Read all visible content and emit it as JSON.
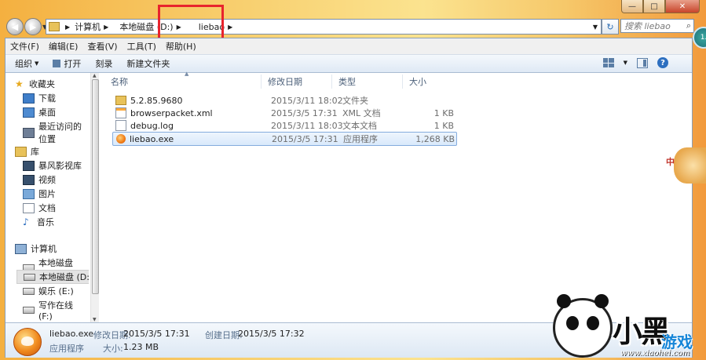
{
  "window": {
    "controls": {
      "minimize": "—",
      "maximize": "□",
      "close": "✕"
    }
  },
  "address_bar": {
    "crumbs": [
      "计算机",
      "本地磁盘 (D:)",
      "liebao"
    ],
    "search_placeholder": "搜索 liebao"
  },
  "menu": [
    "文件(F)",
    "编辑(E)",
    "查看(V)",
    "工具(T)",
    "帮助(H)"
  ],
  "toolbar": {
    "organize": "组织",
    "open": "打开",
    "burn": "刻录",
    "new_folder": "新建文件夹"
  },
  "sidebar": {
    "favorites": {
      "label": "收藏夹",
      "items": [
        "下载",
        "桌面",
        "最近访问的位置"
      ]
    },
    "libraries": {
      "label": "库",
      "items": [
        "暴风影视库",
        "视频",
        "图片",
        "文档",
        "音乐"
      ]
    },
    "computer": {
      "label": "计算机",
      "items": [
        "本地磁盘 (C:)",
        "本地磁盘 (D:)",
        "娱乐 (E:)",
        "写作在线 (F:)"
      ],
      "selected": "本地磁盘 (D:)"
    }
  },
  "columns": [
    "名称",
    "修改日期",
    "类型",
    "大小"
  ],
  "files": [
    {
      "name": "5.2.85.9680",
      "date": "2015/3/11 18:02",
      "type": "文件夹",
      "size": "",
      "icon": "folder-icon"
    },
    {
      "name": "browserpacket.xml",
      "date": "2015/3/5 17:31",
      "type": "XML 文档",
      "size": "1 KB",
      "icon": "xml-file-icon"
    },
    {
      "name": "debug.log",
      "date": "2015/3/11 18:03",
      "type": "文本文档",
      "size": "1 KB",
      "icon": "text-file-icon"
    },
    {
      "name": "liebao.exe",
      "date": "2015/3/5 17:31",
      "type": "应用程序",
      "size": "1,268 KB",
      "icon": "liebao-app-icon"
    }
  ],
  "details": {
    "name": "liebao.exe",
    "type": "应用程序",
    "modified_label": "修改日期:",
    "modified": "2015/3/5 17:31",
    "size_label": "大小:",
    "size": "1.23 MB",
    "created_label": "创建日期:",
    "created": "2015/3/5 17:32"
  },
  "overlay": {
    "logo": "小黑",
    "logo_sub": "游戏",
    "url": "www.xiaohei.com",
    "side_badge": "中",
    "top_badge": "1."
  }
}
